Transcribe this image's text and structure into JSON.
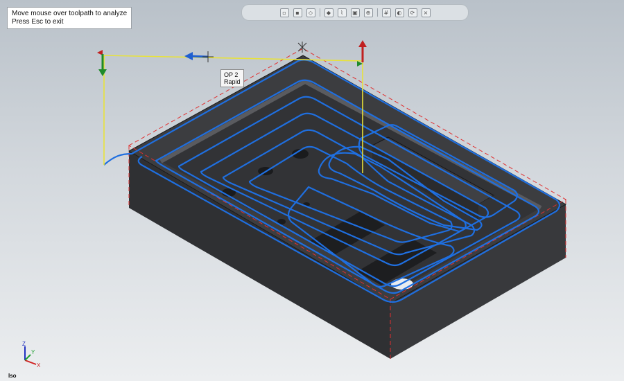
{
  "hint": {
    "line1": "Move mouse over toolpath to analyze",
    "line2": "Press Esc to exit"
  },
  "toolbar": {
    "buttons": [
      "save-icon",
      "layers-icon",
      "wireframe-icon",
      "shaded-icon",
      "toolpath-icon",
      "stock-icon",
      "zoom-fit-icon",
      "grid-icon",
      "color-icon",
      "rotate-icon",
      "close-icon"
    ],
    "glyphs": [
      "▫",
      "▪",
      "◇",
      "◆",
      "⌇",
      "▣",
      "⊕",
      "#",
      "◐",
      "⟳",
      "×"
    ]
  },
  "op_tag": {
    "line1": "OP 2",
    "line2": "Rapid"
  },
  "triad": {
    "z": "Z",
    "y": "Y",
    "x": "X"
  },
  "view_name": "Iso",
  "colors": {
    "toolpath": "#1f6fe0",
    "rapid": "#e8e23a",
    "stock_boundary": "#e03030",
    "part_top": "#3c3d40",
    "part_side_left": "#2e2f31",
    "part_side_front": "#36373a"
  }
}
